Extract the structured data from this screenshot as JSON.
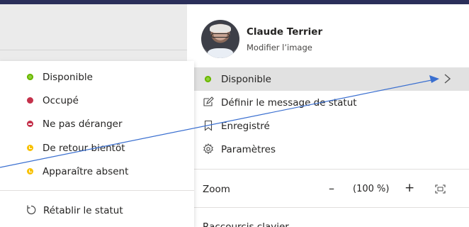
{
  "status_menu": {
    "items": [
      {
        "label": "Disponible",
        "color": "#6bb700",
        "icon": "available-dot-icon"
      },
      {
        "label": "Occupé",
        "color": "#c4314b",
        "icon": "busy-dot-icon"
      },
      {
        "label": "Ne pas déranger",
        "color": "#c4314b",
        "icon": "do-not-disturb-icon"
      },
      {
        "label": "De retour bientôt",
        "color": "#f8c100",
        "icon": "be-right-back-icon"
      },
      {
        "label": "Apparaître absent",
        "color": "#f8c100",
        "icon": "appear-away-icon"
      }
    ],
    "reset_label": "Rétablir le statut",
    "reset_icon": "reset-icon"
  },
  "profile": {
    "name": "Claude Terrier",
    "edit_image": "Modifier l’image",
    "status_label": "Disponible",
    "status_color": "#6bb700",
    "items": [
      {
        "label": "Définir le message de statut",
        "icon": "edit-message-icon"
      },
      {
        "label": "Enregistré",
        "icon": "bookmark-icon"
      },
      {
        "label": "Paramètres",
        "icon": "gear-icon"
      }
    ],
    "zoom": {
      "label": "Zoom",
      "minus": "–",
      "value": "(100 %)",
      "plus": "+"
    },
    "cut_text": "Raccourcis clavier"
  },
  "colors": {
    "top_bar": "#2b2f5a",
    "annotation_arrow": "#3a6fd0",
    "selected_row": "#e1e1e1"
  }
}
